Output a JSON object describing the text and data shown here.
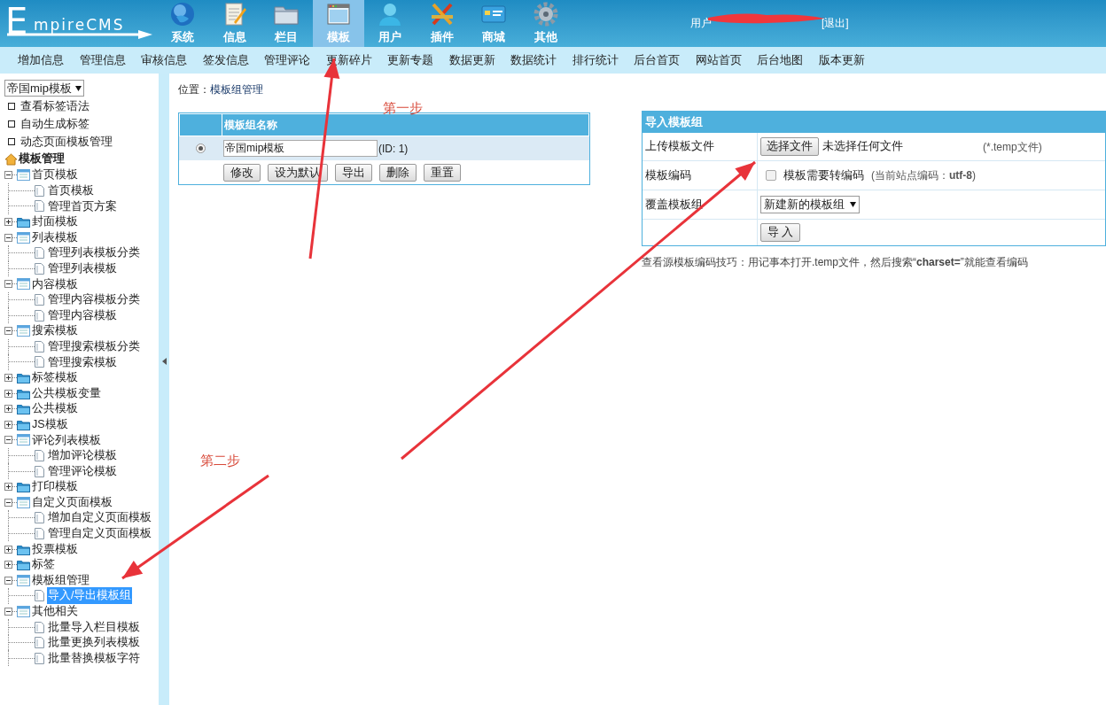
{
  "header": {
    "logo": {
      "initial": "E",
      "rest": "mpireCMS"
    },
    "nav": [
      {
        "label": "系统",
        "selected": false
      },
      {
        "label": "信息",
        "selected": false
      },
      {
        "label": "栏目",
        "selected": false
      },
      {
        "label": "模板",
        "selected": true
      },
      {
        "label": "用户",
        "selected": false
      },
      {
        "label": "插件",
        "selected": false
      },
      {
        "label": "商城",
        "selected": false
      },
      {
        "label": "其他",
        "selected": false
      }
    ],
    "user": {
      "label": "用户",
      "logout": "[退出]"
    }
  },
  "menu": [
    "增加信息",
    "管理信息",
    "审核信息",
    "签发信息",
    "管理评论",
    "更新碎片",
    "更新专题",
    "数据更新",
    "数据统计",
    "排行统计",
    "后台首页",
    "网站首页",
    "后台地图",
    "版本更新"
  ],
  "sidebar": {
    "select": "帝国mip模板",
    "links": [
      "查看标签语法",
      "自动生成标签",
      "动态页面模板管理"
    ],
    "tree_title": "模板管理",
    "tree": [
      {
        "label": "首页模板",
        "expanded": true,
        "children": [
          {
            "label": "首页模板",
            "selected": false
          },
          {
            "label": "管理首页方案",
            "selected": false
          }
        ]
      },
      {
        "label": "封面模板",
        "expanded": false
      },
      {
        "label": "列表模板",
        "expanded": true,
        "children": [
          {
            "label": "管理列表模板分类",
            "selected": false
          },
          {
            "label": "管理列表模板",
            "selected": false
          }
        ]
      },
      {
        "label": "内容模板",
        "expanded": true,
        "children": [
          {
            "label": "管理内容模板分类",
            "selected": false
          },
          {
            "label": "管理内容模板",
            "selected": false
          }
        ]
      },
      {
        "label": "搜索模板",
        "expanded": true,
        "children": [
          {
            "label": "管理搜索模板分类",
            "selected": false
          },
          {
            "label": "管理搜索模板",
            "selected": false
          }
        ]
      },
      {
        "label": "标签模板",
        "expanded": false
      },
      {
        "label": "公共模板变量",
        "expanded": false
      },
      {
        "label": "公共模板",
        "expanded": false
      },
      {
        "label": "JS模板",
        "expanded": false
      },
      {
        "label": "评论列表模板",
        "expanded": true,
        "children": [
          {
            "label": "增加评论模板",
            "selected": false
          },
          {
            "label": "管理评论模板",
            "selected": false
          }
        ]
      },
      {
        "label": "打印模板",
        "expanded": false
      },
      {
        "label": "自定义页面模板",
        "expanded": true,
        "children": [
          {
            "label": "增加自定义页面模板",
            "selected": false
          },
          {
            "label": "管理自定义页面模板",
            "selected": false
          }
        ]
      },
      {
        "label": "投票模板",
        "expanded": false
      },
      {
        "label": "标签",
        "expanded": false
      },
      {
        "label": "模板组管理",
        "expanded": true,
        "children": [
          {
            "label": "导入/导出模板组",
            "selected": true
          }
        ]
      },
      {
        "label": "其他相关",
        "expanded": true,
        "children": [
          {
            "label": "批量导入栏目模板",
            "selected": false
          },
          {
            "label": "批量更换列表模板",
            "selected": false
          },
          {
            "label": "批量替换模板字符",
            "selected": false
          }
        ]
      }
    ]
  },
  "main": {
    "breadcrumb": {
      "label": "位置：",
      "link": "模板组管理"
    },
    "group_table": {
      "header": "模板组名称",
      "rows": [
        {
          "selected": true,
          "name": "帝国mip模板",
          "id": "(ID: 1)"
        }
      ],
      "buttons": [
        "修改",
        "设为默认",
        "导出",
        "删除",
        "重置"
      ]
    },
    "import_panel": {
      "title": "导入模板组",
      "rows": [
        {
          "kind": "file",
          "label": "上传模板文件",
          "button": "选择文件",
          "status": "未选择任何文件",
          "hint": "(*.temp文件)"
        },
        {
          "kind": "checkbox",
          "label": "模板编码",
          "checked": false,
          "text": "模板需要转编码",
          "note": "(当前站点编码：**utf-8**)"
        },
        {
          "kind": "select",
          "label": "覆盖模板组",
          "value": "新建新的模板组"
        },
        {
          "kind": "submit",
          "button": "导 入"
        }
      ],
      "tip": "查看源模板编码技巧：用记事本打开.temp文件，然后搜索“**charset=**”就能查看编码"
    }
  },
  "annotations": [
    {
      "text": "第一步"
    },
    {
      "text": "第二步"
    }
  ]
}
